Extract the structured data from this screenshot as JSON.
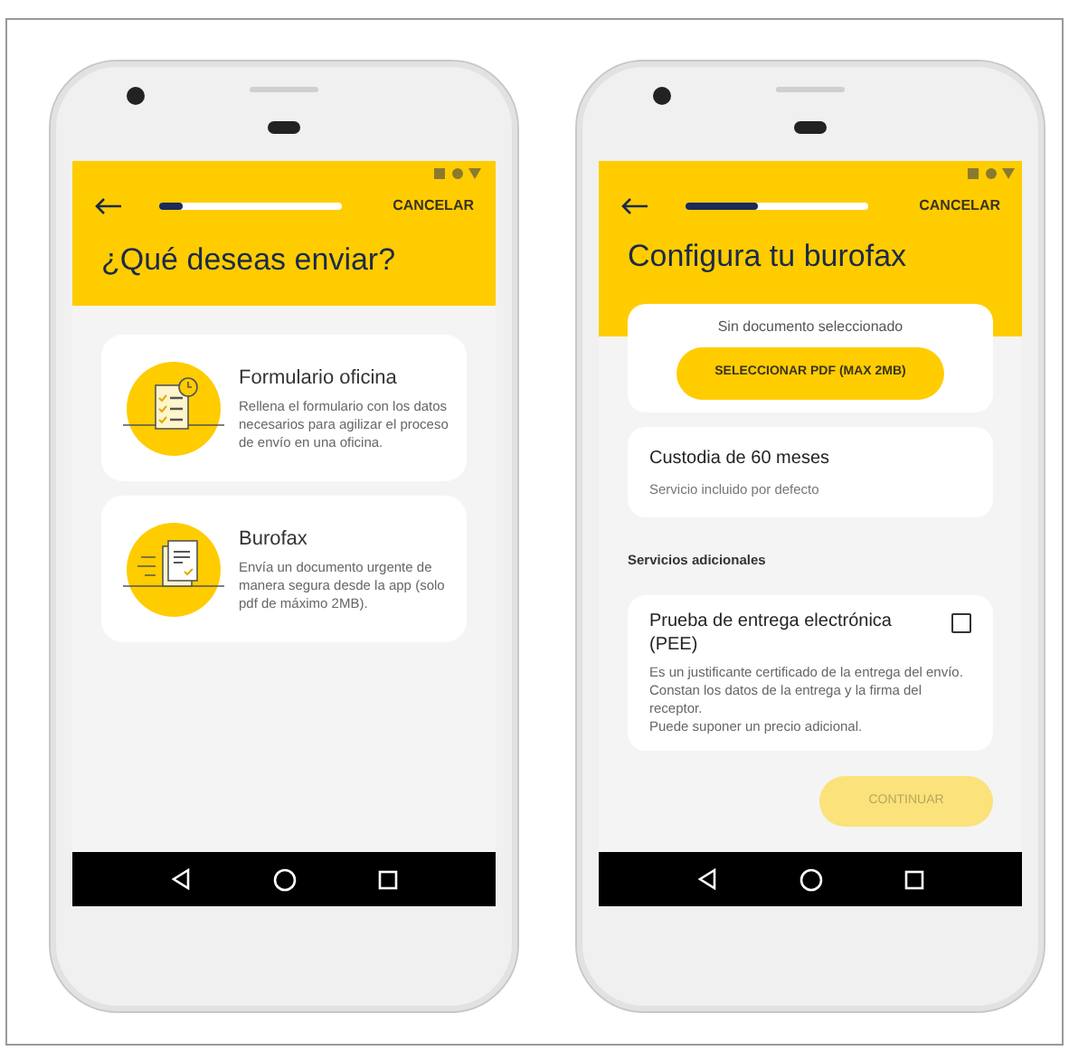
{
  "phones": [
    {
      "kind": "choice",
      "progress": {
        "level": 0.13
      },
      "cancel": "CANCELAR",
      "title": "¿Qué deseas enviar?",
      "options": [
        {
          "kind": "form",
          "title": "Formulario oficina",
          "description": "Rellena el formulario con los datos necesarios para agilizar el proceso de envío en una oficina."
        },
        {
          "kind": "burofax",
          "title": "Burofax",
          "description": "Envía un documento urgente de manera segura desde la app (solo pdf de máximo 2MB)."
        }
      ]
    },
    {
      "kind": "config",
      "progress": {
        "level": 0.4
      },
      "cancel": "CANCELAR",
      "title": "Configura tu burofax",
      "document": {
        "status": "Sin documento seleccionado",
        "button": "SELECCIONAR PDF (MAX 2MB)"
      },
      "custody": {
        "title": "Custodia de 60 meses",
        "subtitle": "Servicio incluido por defecto"
      },
      "section": "Servicios adicionales",
      "extra": {
        "title": "Prueba de entrega electrónica (PEE)",
        "checked": false,
        "description": [
          "Es un justificante certificado de la entrega del envío. Constan los datos de la entrega y la firma del receptor.",
          "Puede suponer un precio adicional."
        ]
      },
      "continue": {
        "label": "CONTINUAR",
        "disabled": true
      }
    }
  ]
}
